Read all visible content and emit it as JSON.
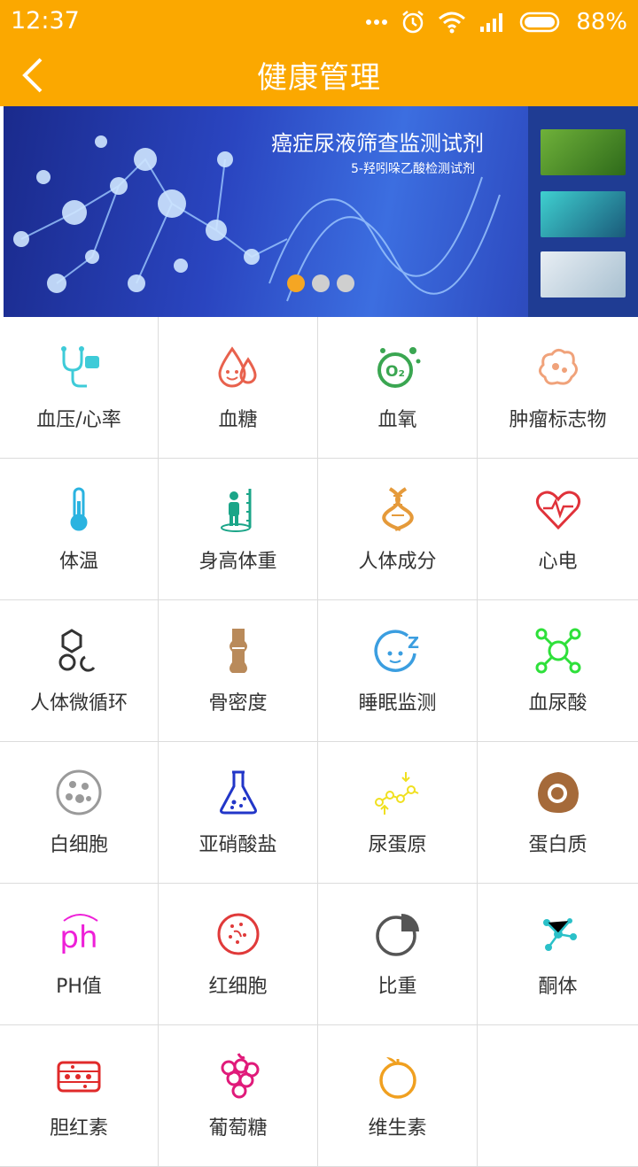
{
  "status_bar": {
    "time": "12:37",
    "battery": "88%"
  },
  "app_bar": {
    "title": "健康管理"
  },
  "banner": {
    "title": "癌症尿液筛查监测试剂",
    "subtitle": "5-羟吲哚乙酸检测试剂",
    "pages": 3,
    "active_page": 1
  },
  "grid": [
    {
      "label": "血压/心率",
      "icon": "stethoscope-icon",
      "color": "#3ecbd8"
    },
    {
      "label": "血糖",
      "icon": "blood-drop-icon",
      "color": "#e8614d"
    },
    {
      "label": "血氧",
      "icon": "oxygen-icon",
      "color": "#3aa651"
    },
    {
      "label": "肿瘤标志物",
      "icon": "tumor-icon",
      "color": "#f0a27a"
    },
    {
      "label": "体温",
      "icon": "thermometer-icon",
      "color": "#2ab3e0"
    },
    {
      "label": "身高体重",
      "icon": "height-weight-icon",
      "color": "#1aa588"
    },
    {
      "label": "人体成分",
      "icon": "dna-icon",
      "color": "#e59a3a"
    },
    {
      "label": "心电",
      "icon": "heart-ecg-icon",
      "color": "#e0323a"
    },
    {
      "label": "人体微循环",
      "icon": "microcirculation-icon",
      "color": "#333333"
    },
    {
      "label": "骨密度",
      "icon": "bone-joint-icon",
      "color": "#b98a5a"
    },
    {
      "label": "睡眠监测",
      "icon": "sleep-icon",
      "color": "#3b9ee0"
    },
    {
      "label": "血尿酸",
      "icon": "molecule-icon",
      "color": "#2ee03a"
    },
    {
      "label": "白细胞",
      "icon": "white-cell-icon",
      "color": "#9a9a9a"
    },
    {
      "label": "亚硝酸盐",
      "icon": "flask-icon",
      "color": "#2236c8"
    },
    {
      "label": "尿蛋原",
      "icon": "bead-chain-icon",
      "color": "#f0e020"
    },
    {
      "label": "蛋白质",
      "icon": "egg-icon",
      "color": "#a56a3a"
    },
    {
      "label": "PH值",
      "icon": "ph-icon",
      "color": "#ee20d8"
    },
    {
      "label": "红细胞",
      "icon": "red-cell-icon",
      "color": "#e03a3a"
    },
    {
      "label": "比重",
      "icon": "pie-chart-icon",
      "color": "#555555"
    },
    {
      "label": "酮体",
      "icon": "ketone-icon",
      "color": "#2ac0c8"
    },
    {
      "label": "胆红素",
      "icon": "bilirubin-icon",
      "color": "#e02a2a"
    },
    {
      "label": "葡萄糖",
      "icon": "grape-icon",
      "color": "#e01a7a"
    },
    {
      "label": "维生素",
      "icon": "orange-icon",
      "color": "#f0a020"
    },
    {
      "label": "",
      "icon": "",
      "color": ""
    }
  ]
}
